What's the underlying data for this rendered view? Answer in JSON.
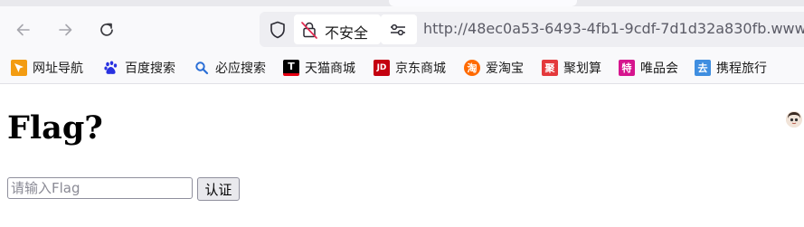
{
  "browser": {
    "security_label": "不安全",
    "url": "http://48ec0a53-6493-4fb1-9cdf-7d1d32a830fb.www"
  },
  "bookmarks": [
    {
      "label": "网址导航",
      "icon": "navigation-icon",
      "color": "#f39c12",
      "glyph": ""
    },
    {
      "label": "百度搜索",
      "icon": "baidu-paw-icon",
      "color": "#2932e1",
      "glyph": ""
    },
    {
      "label": "必应搜索",
      "icon": "search-icon",
      "color": "#2b6fd6",
      "glyph": ""
    },
    {
      "label": "天猫商城",
      "icon": "tmall-icon",
      "color": "#e60012",
      "glyph": "T"
    },
    {
      "label": "京东商城",
      "icon": "jd-icon",
      "color": "#c40010",
      "glyph": "JD"
    },
    {
      "label": "爱淘宝",
      "icon": "taobao-icon",
      "color": "#ff6a00",
      "glyph": "淘"
    },
    {
      "label": "聚划算",
      "icon": "juhuasuan-icon",
      "color": "#e4393c",
      "glyph": "聚"
    },
    {
      "label": "唯品会",
      "icon": "vip-icon",
      "color": "#d6158e",
      "glyph": "特"
    },
    {
      "label": "携程旅行",
      "icon": "ctrip-icon",
      "color": "#3f8ee0",
      "glyph": "去"
    }
  ],
  "page": {
    "title": "Flag?",
    "input_placeholder": "请输入Flag",
    "submit_label": "认证"
  }
}
